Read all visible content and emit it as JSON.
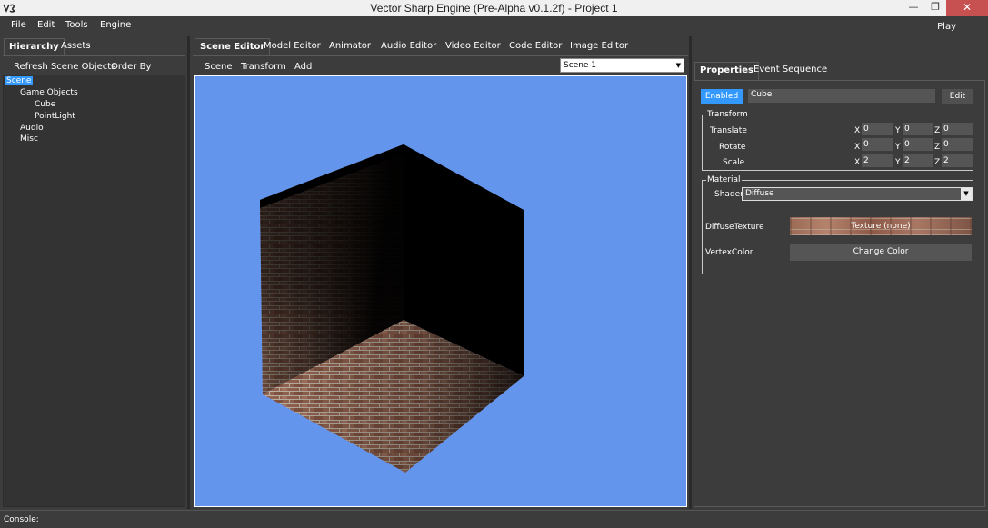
{
  "window": {
    "title": "Vector Sharp Engine (Pre-Alpha v0.1.2f) - Project 1",
    "minimize_glyph": "—",
    "maximize_glyph": "❐",
    "close_glyph": "✕"
  },
  "menu": {
    "items": [
      "File",
      "Edit",
      "Tools",
      "Engine"
    ],
    "play": "Play"
  },
  "left_panel": {
    "tabs": [
      "Hierarchy",
      "Assets"
    ],
    "toolbar": [
      "Refresh Scene Objects",
      "Order By"
    ],
    "tree": [
      "Scene",
      "Game Objects",
      "Cube",
      "PointLight",
      "Audio",
      "Misc"
    ]
  },
  "editor_tabs": [
    "Scene Editor",
    "Model Editor",
    "Animator",
    "Audio Editor",
    "Video Editor",
    "Code Editor",
    "Image Editor"
  ],
  "scene_toolbar": {
    "items": [
      "Scene",
      "Transform",
      "Add"
    ],
    "scene_select": "Scene 1"
  },
  "right_panel": {
    "tabs": [
      "Properties",
      "Event Sequence"
    ],
    "enabled_label": "Enabled",
    "object_name": "Cube",
    "edit_label": "Edit",
    "transform": {
      "title": "Transform",
      "rows": [
        {
          "label": "Translate",
          "x": "0",
          "y": "0",
          "z": "0"
        },
        {
          "label": "Rotate",
          "x": "0",
          "y": "0",
          "z": "0"
        },
        {
          "label": "Scale",
          "x": "2",
          "y": "2",
          "z": "2"
        }
      ],
      "axes": [
        "X",
        "Y",
        "Z"
      ]
    },
    "material": {
      "title": "Material",
      "shader_label": "Shader",
      "shader_value": "Diffuse",
      "diffuse_label": "DiffuseTexture",
      "texture_button": "Texture (none)",
      "vertex_label": "VertexColor",
      "color_button": "Change Color"
    }
  },
  "console": {
    "label": "Console:"
  },
  "colors": {
    "background": "#3c3c3c",
    "viewport": "#6495ed",
    "accent": "#3399ff"
  }
}
